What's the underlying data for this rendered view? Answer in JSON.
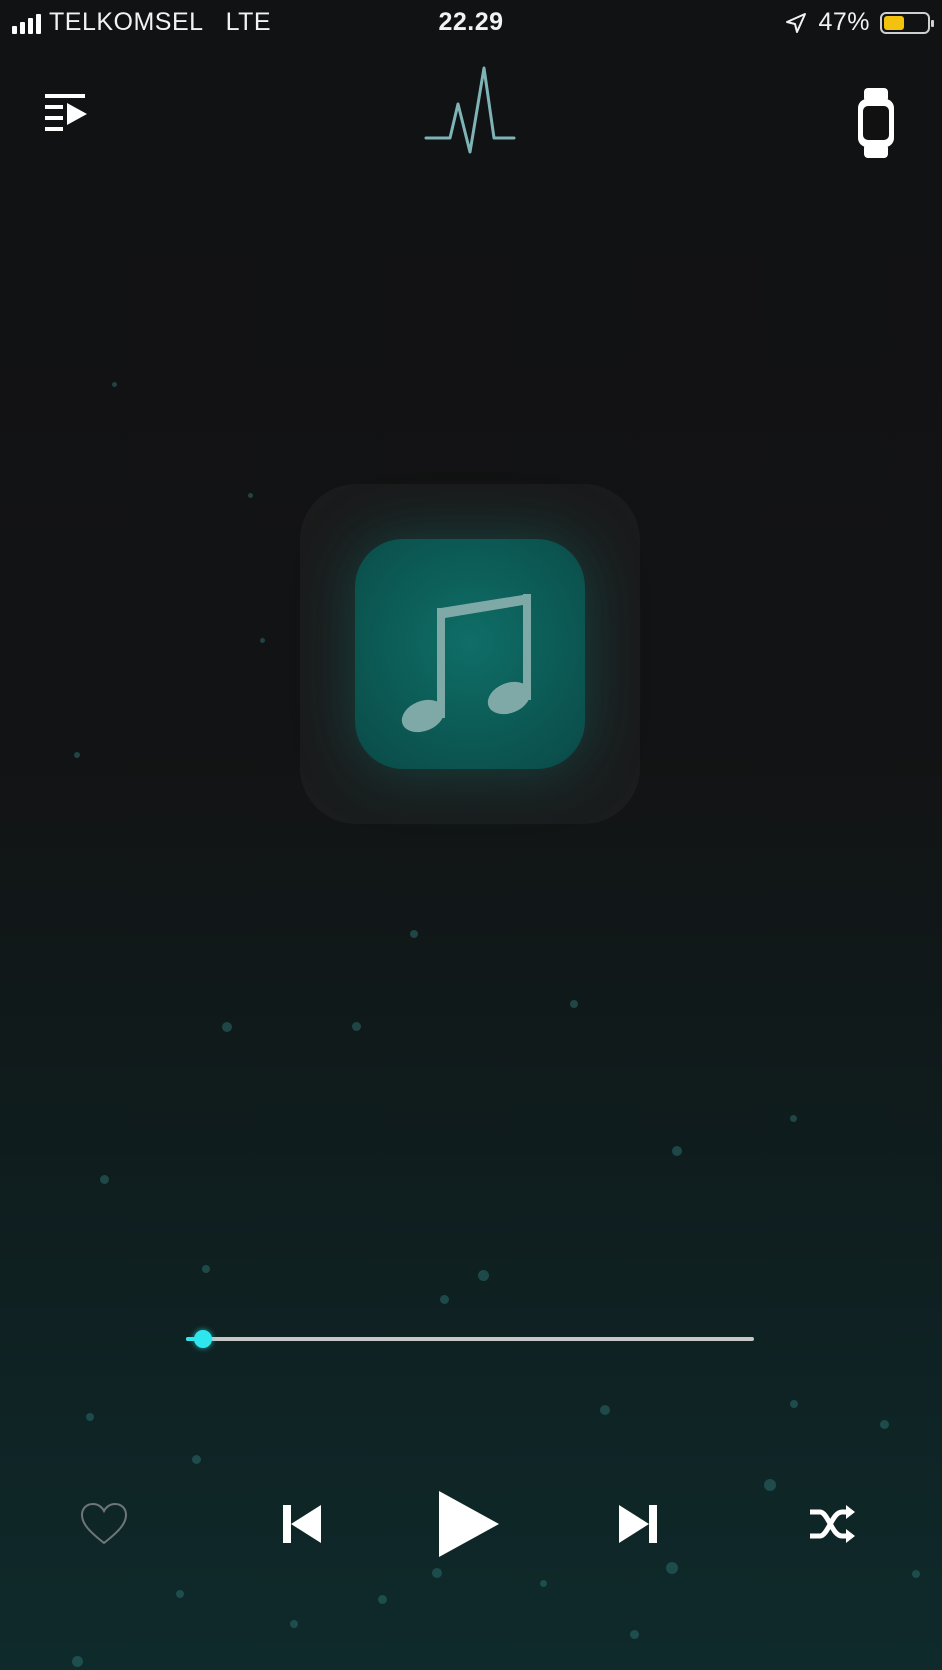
{
  "status_bar": {
    "carrier": "TELKOMSEL",
    "network": "LTE",
    "time": "22.29",
    "battery_percent_label": "47%",
    "battery_level": 0.47
  },
  "player": {
    "progress_fraction": 0.03
  },
  "colors": {
    "accent": "#2ee6ee",
    "artwork": "#0c5a55",
    "battery": "#f2c20f"
  },
  "icons": {
    "queue": "playlist-icon",
    "logo": "waveform-logo-icon",
    "watch": "apple-watch-icon",
    "artwork": "music-note-icon",
    "like": "heart-icon",
    "previous": "skip-previous-icon",
    "play": "play-icon",
    "next": "skip-next-icon",
    "shuffle": "shuffle-icon"
  }
}
